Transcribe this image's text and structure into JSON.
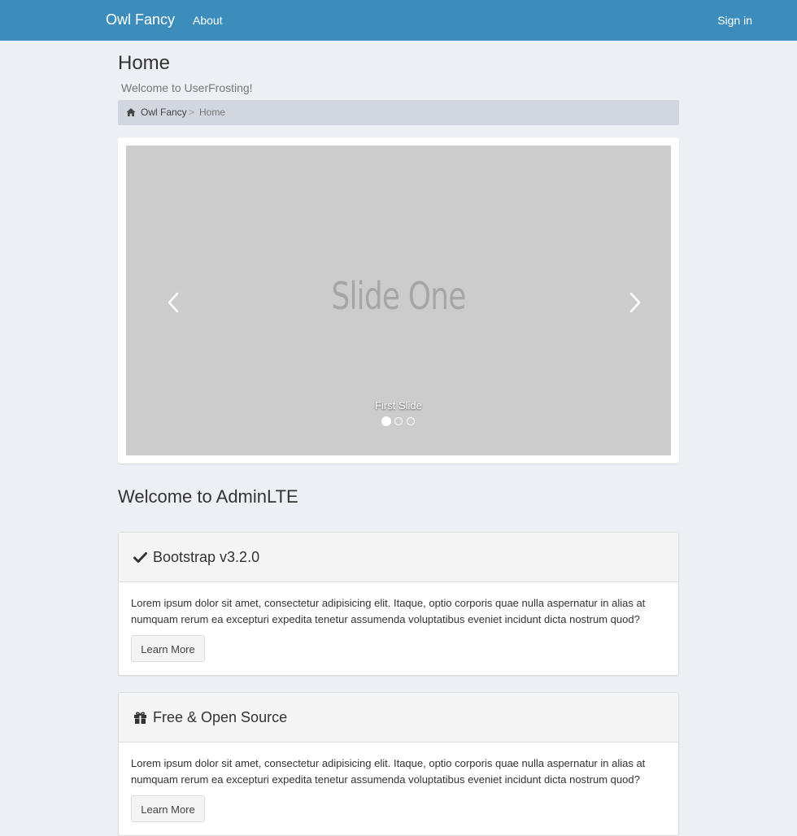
{
  "navbar": {
    "brand": "Owl Fancy",
    "about": "About",
    "signin": "Sign in"
  },
  "page": {
    "title": "Home",
    "subtitle": "Welcome to UserFrosting!"
  },
  "breadcrumb": {
    "items": [
      "Owl Fancy",
      "Home"
    ],
    "separator": ">"
  },
  "carousel": {
    "slide_text": "Slide One",
    "caption": "First Slide",
    "slide_count": 3,
    "active_index": 0
  },
  "section_title": "Welcome to AdminLTE",
  "boxes": [
    {
      "icon": "check-icon",
      "title": "Bootstrap v3.2.0",
      "body": "Lorem ipsum dolor sit amet, consectetur adipisicing elit. Itaque, optio corporis quae nulla aspernatur in alias at numquam rerum ea excepturi expedita tenetur assumenda voluptatibus eveniet incidunt dicta nostrum quod?",
      "button": "Learn More"
    },
    {
      "icon": "gift-icon",
      "title": "Free & Open Source",
      "body": "Lorem ipsum dolor sit amet, consectetur adipisicing elit. Itaque, optio corporis quae nulla aspernatur in alias at numquam rerum ea excepturi expedita tenetur assumenda voluptatibus eveniet incidunt dicta nostrum quod?",
      "button": "Learn More"
    }
  ],
  "colors": {
    "navbar": "#3c8dbc",
    "background": "#ecf0f5",
    "breadcrumb": "#d2d6de",
    "carousel": "#cccccc"
  }
}
